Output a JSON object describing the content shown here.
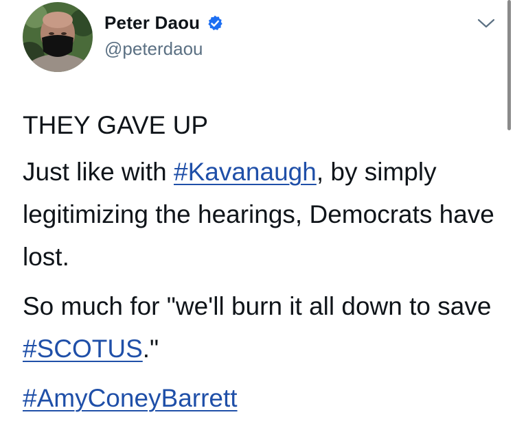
{
  "author": {
    "display_name": "Peter Daou",
    "handle": "@peterdaou",
    "verified_icon": "verified-badge-icon",
    "verified_color": "#1d6ff2",
    "avatar_icon": "avatar-photo"
  },
  "menu": {
    "icon": "chevron-down-icon"
  },
  "tweet": {
    "line1": "THEY GAVE UP",
    "p2_part1": "Just like with ",
    "p2_hashtag": "#Kavanaugh",
    "p2_part2": ", by simply legitimizing the hearings, Democrats have lost.",
    "p3_part1": "So much for \"we'll burn it all down to save ",
    "p3_hashtag": "#SCOTUS",
    "p3_part2": ".\"",
    "p4_hashtag": "#AmyConeyBarrett"
  },
  "colors": {
    "hashtag": "#1f4fa8",
    "handle": "#5b7083",
    "text": "#0f1419"
  }
}
